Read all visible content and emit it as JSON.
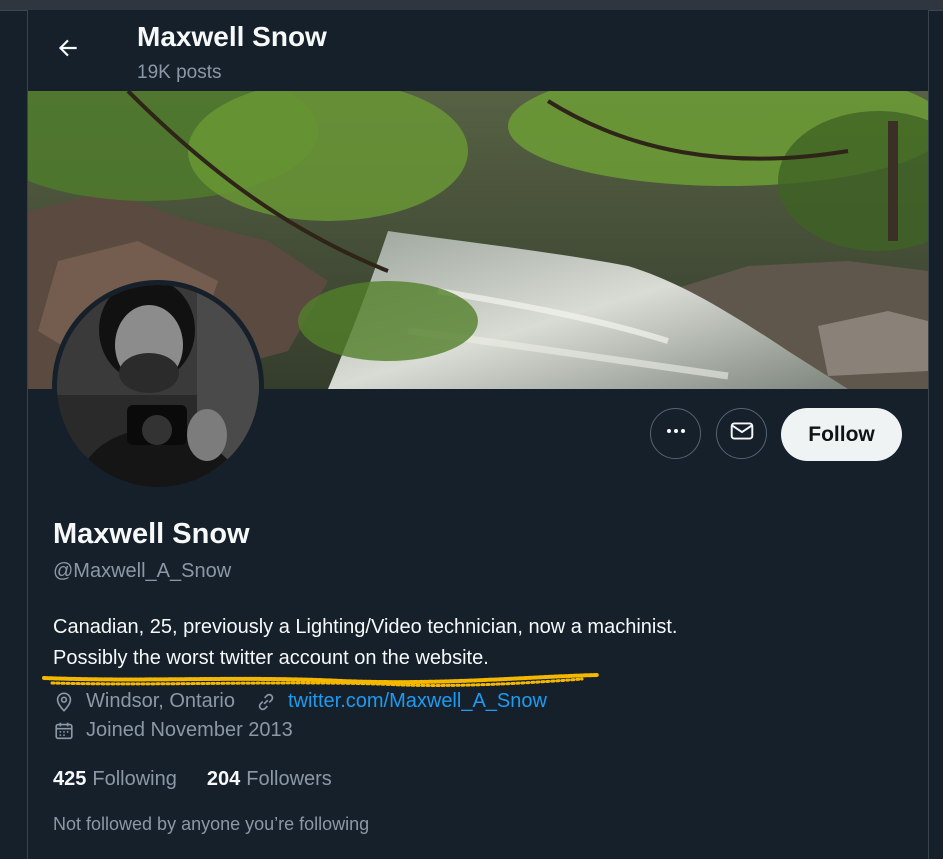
{
  "header": {
    "back_icon": "arrow-left-icon",
    "name": "Maxwell Snow",
    "posts": "19K posts"
  },
  "profile": {
    "display_name": "Maxwell Snow",
    "handle": "@Maxwell_A_Snow",
    "bio_line1": "Canadian, 25,  previously a Lighting/Video technician, now a machinist.",
    "bio_line2": "Possibly the worst twitter account on the website.",
    "location": "Windsor, Ontario",
    "website": "twitter.com/Maxwell_A_Snow",
    "joined": "Joined November 2013",
    "following_count": "425",
    "following_label": "Following",
    "followers_count": "204",
    "followers_label": "Followers",
    "not_followed": "Not followed by anyone you’re following"
  },
  "actions": {
    "more_icon": "more-horizontal-icon",
    "message_icon": "envelope-icon",
    "follow_label": "Follow"
  },
  "colors": {
    "background": "#15202b",
    "text_primary": "#f7f9f9",
    "text_secondary": "#8b98a5",
    "link": "#1d9bf0",
    "highlight_scribble": "#f5b800"
  }
}
